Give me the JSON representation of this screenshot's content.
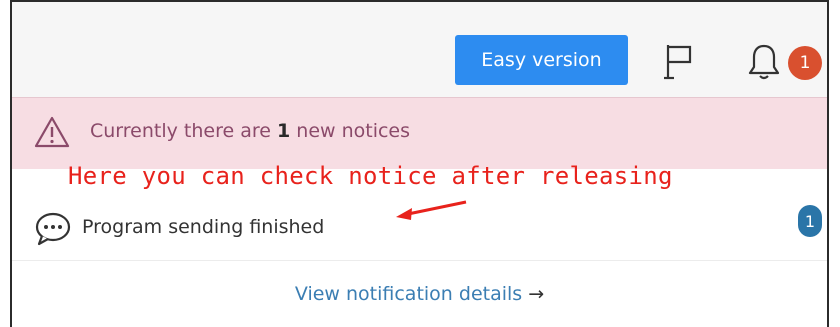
{
  "header": {
    "easy_version_label": "Easy version",
    "bell_badge_count": "1"
  },
  "alert": {
    "prefix": "Currently there are ",
    "count": "1",
    "suffix": " new notices"
  },
  "annotation": {
    "text": "Here you can check notice after releasing",
    "color": "#e8221c"
  },
  "notice": {
    "text": "Program sending finished",
    "badge": "1",
    "icon": "chat-bubble-icon"
  },
  "footer": {
    "view_details_label": "View notification details",
    "arrow": "→"
  },
  "colors": {
    "primary": "#2d8cf0",
    "alert_bg": "#f7dde3",
    "badge_red": "#d9502f",
    "badge_blue": "#2a75a8"
  }
}
